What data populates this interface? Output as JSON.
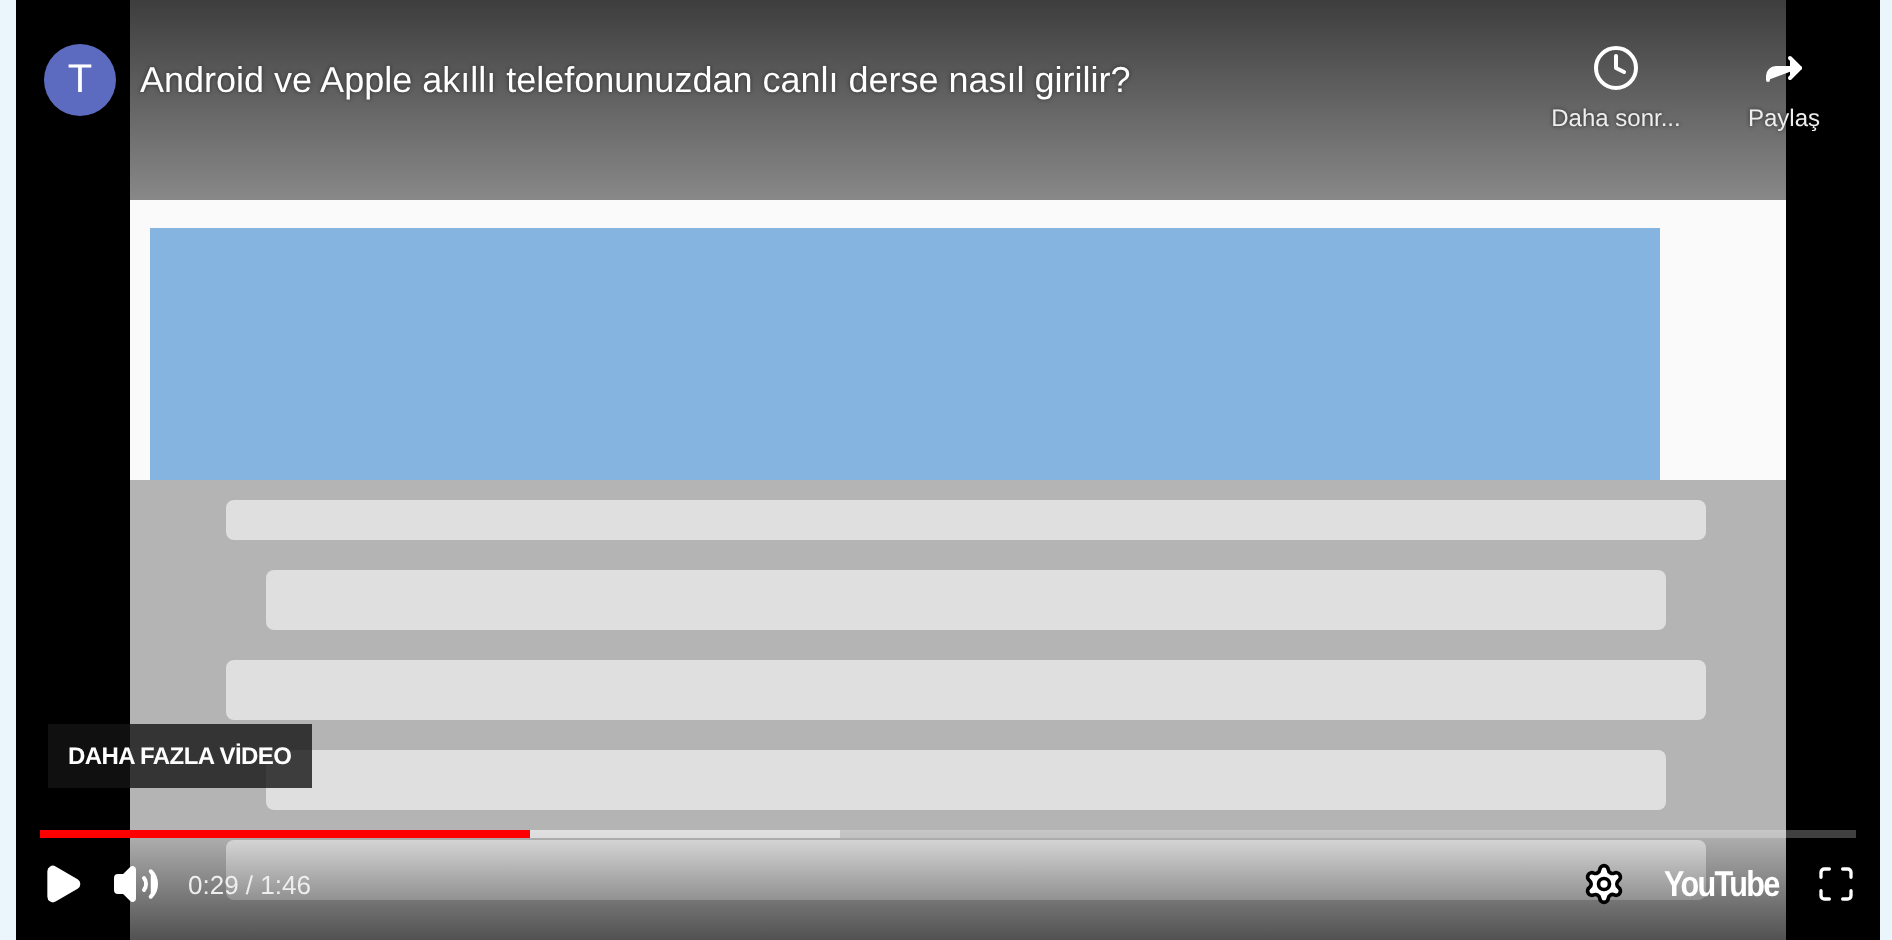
{
  "channel": {
    "avatar": "T"
  },
  "title": "Android ve Apple akıllı telefonunuzdan canlı derse nasıl girilir?",
  "actions": [
    {
      "kind": "watch_later",
      "label": "Daha sonr..."
    },
    {
      "kind": "share",
      "label": "Paylaş"
    }
  ],
  "more_videos": "DAHA FAZLA VİDEO",
  "progress": {
    "level": 0.27
  },
  "buffer": {
    "level": 0.44
  },
  "time": "0:29 / 1:46",
  "logo": "YouTube"
}
